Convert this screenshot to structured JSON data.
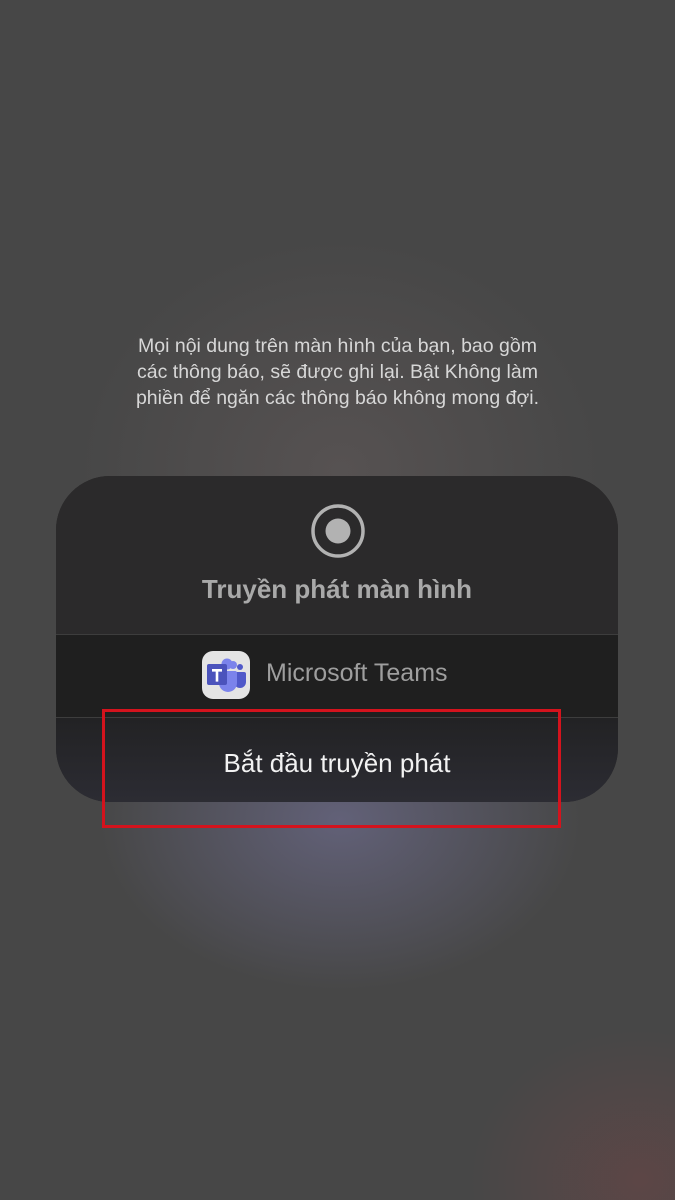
{
  "notice": {
    "line1": "Mọi nội dung trên màn hình của bạn, bao gồm",
    "line2": "các thông báo, sẽ được ghi lại. Bật Không làm",
    "line3": "phiền để ngăn các thông báo không mong đợi."
  },
  "panel": {
    "icon": "record-icon",
    "title": "Truyền phát màn hình",
    "app": {
      "icon": "microsoft-teams-icon",
      "name": "Microsoft Teams"
    },
    "start_label": "Bắt đầu truyền phát"
  },
  "colors": {
    "highlight_border": "#d4131d",
    "teams_purple": "#5b5fc7"
  }
}
